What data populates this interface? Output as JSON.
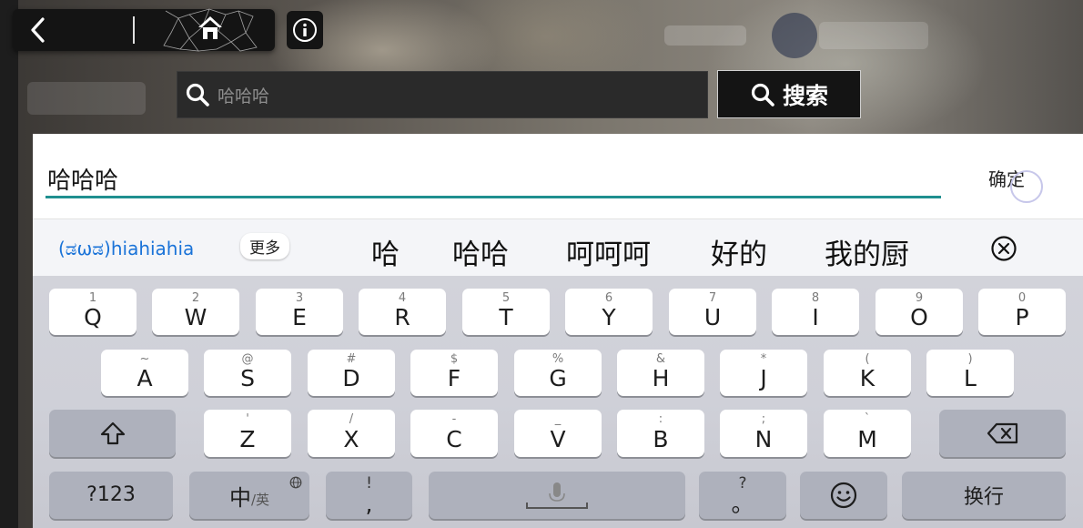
{
  "search": {
    "query": "哈哈哈",
    "button_label": "搜索"
  },
  "input": {
    "text": "哈哈哈",
    "confirm_label": "确定"
  },
  "candidates": {
    "pinyin": "(ಡωಡ)hiahiahia",
    "more_label": "更多",
    "items": [
      "哈",
      "哈哈",
      "呵呵呵",
      "好的",
      "我的厨"
    ]
  },
  "keyboard": {
    "row1": [
      {
        "main": "Q",
        "sup": "1"
      },
      {
        "main": "W",
        "sup": "2"
      },
      {
        "main": "E",
        "sup": "3"
      },
      {
        "main": "R",
        "sup": "4"
      },
      {
        "main": "T",
        "sup": "5"
      },
      {
        "main": "Y",
        "sup": "6"
      },
      {
        "main": "U",
        "sup": "7"
      },
      {
        "main": "I",
        "sup": "8"
      },
      {
        "main": "O",
        "sup": "9"
      },
      {
        "main": "P",
        "sup": "0"
      }
    ],
    "row2": [
      {
        "main": "A",
        "sup": "~"
      },
      {
        "main": "S",
        "sup": "@"
      },
      {
        "main": "D",
        "sup": "#"
      },
      {
        "main": "F",
        "sup": "$"
      },
      {
        "main": "G",
        "sup": "%"
      },
      {
        "main": "H",
        "sup": "&"
      },
      {
        "main": "J",
        "sup": "*"
      },
      {
        "main": "K",
        "sup": "("
      },
      {
        "main": "L",
        "sup": ")"
      }
    ],
    "row3": [
      {
        "main": "Z",
        "sup": "'"
      },
      {
        "main": "X",
        "sup": "/"
      },
      {
        "main": "C",
        "sup": "-"
      },
      {
        "main": "V",
        "sup": "_"
      },
      {
        "main": "B",
        "sup": ":"
      },
      {
        "main": "N",
        "sup": ";"
      },
      {
        "main": "M",
        "sup": "`"
      }
    ],
    "num_label": "?123",
    "lang_main": "中",
    "lang_sub": "/英",
    "comma_sup": "!",
    "comma_main": ",",
    "period_sup": "?",
    "period_main": "。",
    "enter_label": "换行"
  },
  "icons": {
    "back": "chevron-left-icon",
    "home": "home-icon",
    "info": "info-icon",
    "search": "search-icon",
    "close": "close-circle-icon",
    "shift": "shift-icon",
    "backspace": "backspace-icon",
    "globe": "globe-icon",
    "mic": "microphone-icon",
    "emoji": "emoji-icon"
  },
  "colors": {
    "accent": "#1f8f8f",
    "pinyin": "#1a73d8"
  }
}
